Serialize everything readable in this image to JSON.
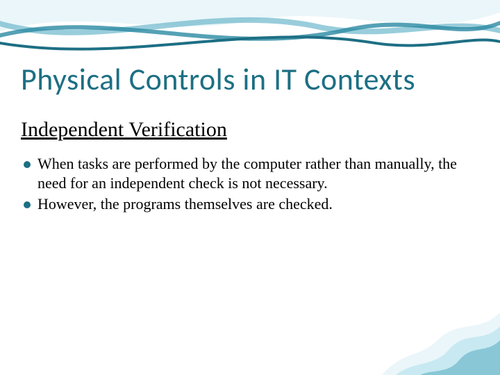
{
  "slide": {
    "title": "Physical Controls in IT Contexts",
    "subtitle": "Independent Verification",
    "bullets": [
      "When tasks are performed by the computer rather than manually, the need for an independent check is not necessary.",
      "However, the programs themselves are checked."
    ]
  },
  "theme": {
    "accent": "#1d6f84",
    "wave_light": "#bfe6ef",
    "wave_mid": "#6db8cc",
    "wave_deep": "#2a8aa3"
  }
}
